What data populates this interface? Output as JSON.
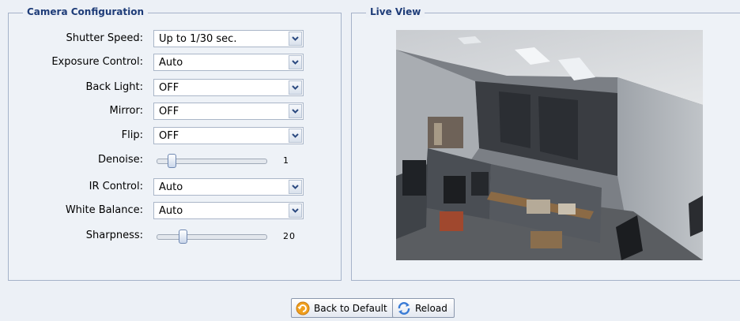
{
  "camera_config": {
    "title": "Camera Configuration",
    "fields": {
      "shutter_speed": {
        "label": "Shutter Speed:",
        "value": "Up to 1/30 sec."
      },
      "exposure_control": {
        "label": "Exposure Control:",
        "value": "Auto"
      },
      "back_light": {
        "label": "Back Light:",
        "value": "OFF"
      },
      "mirror": {
        "label": "Mirror:",
        "value": "OFF"
      },
      "flip": {
        "label": "Flip:",
        "value": "OFF"
      },
      "denoise": {
        "label": "Denoise:",
        "value": "1",
        "level": 0.1
      },
      "ir_control": {
        "label": "IR Control:",
        "value": "Auto"
      },
      "white_balance": {
        "label": "White Balance:",
        "value": "Auto"
      },
      "sharpness": {
        "label": "Sharpness:",
        "value": "20",
        "level": 0.2
      }
    }
  },
  "live_view": {
    "title": "Live View"
  },
  "actions": {
    "back_to_default": "Back to Default",
    "reload": "Reload"
  },
  "icons": {
    "dropdown": "chevron-down-icon",
    "back_to_default": "undo-arrow-icon",
    "reload": "refresh-icon"
  },
  "colors": {
    "legend_text": "#1e3c78",
    "border": "#a5b2c9"
  }
}
